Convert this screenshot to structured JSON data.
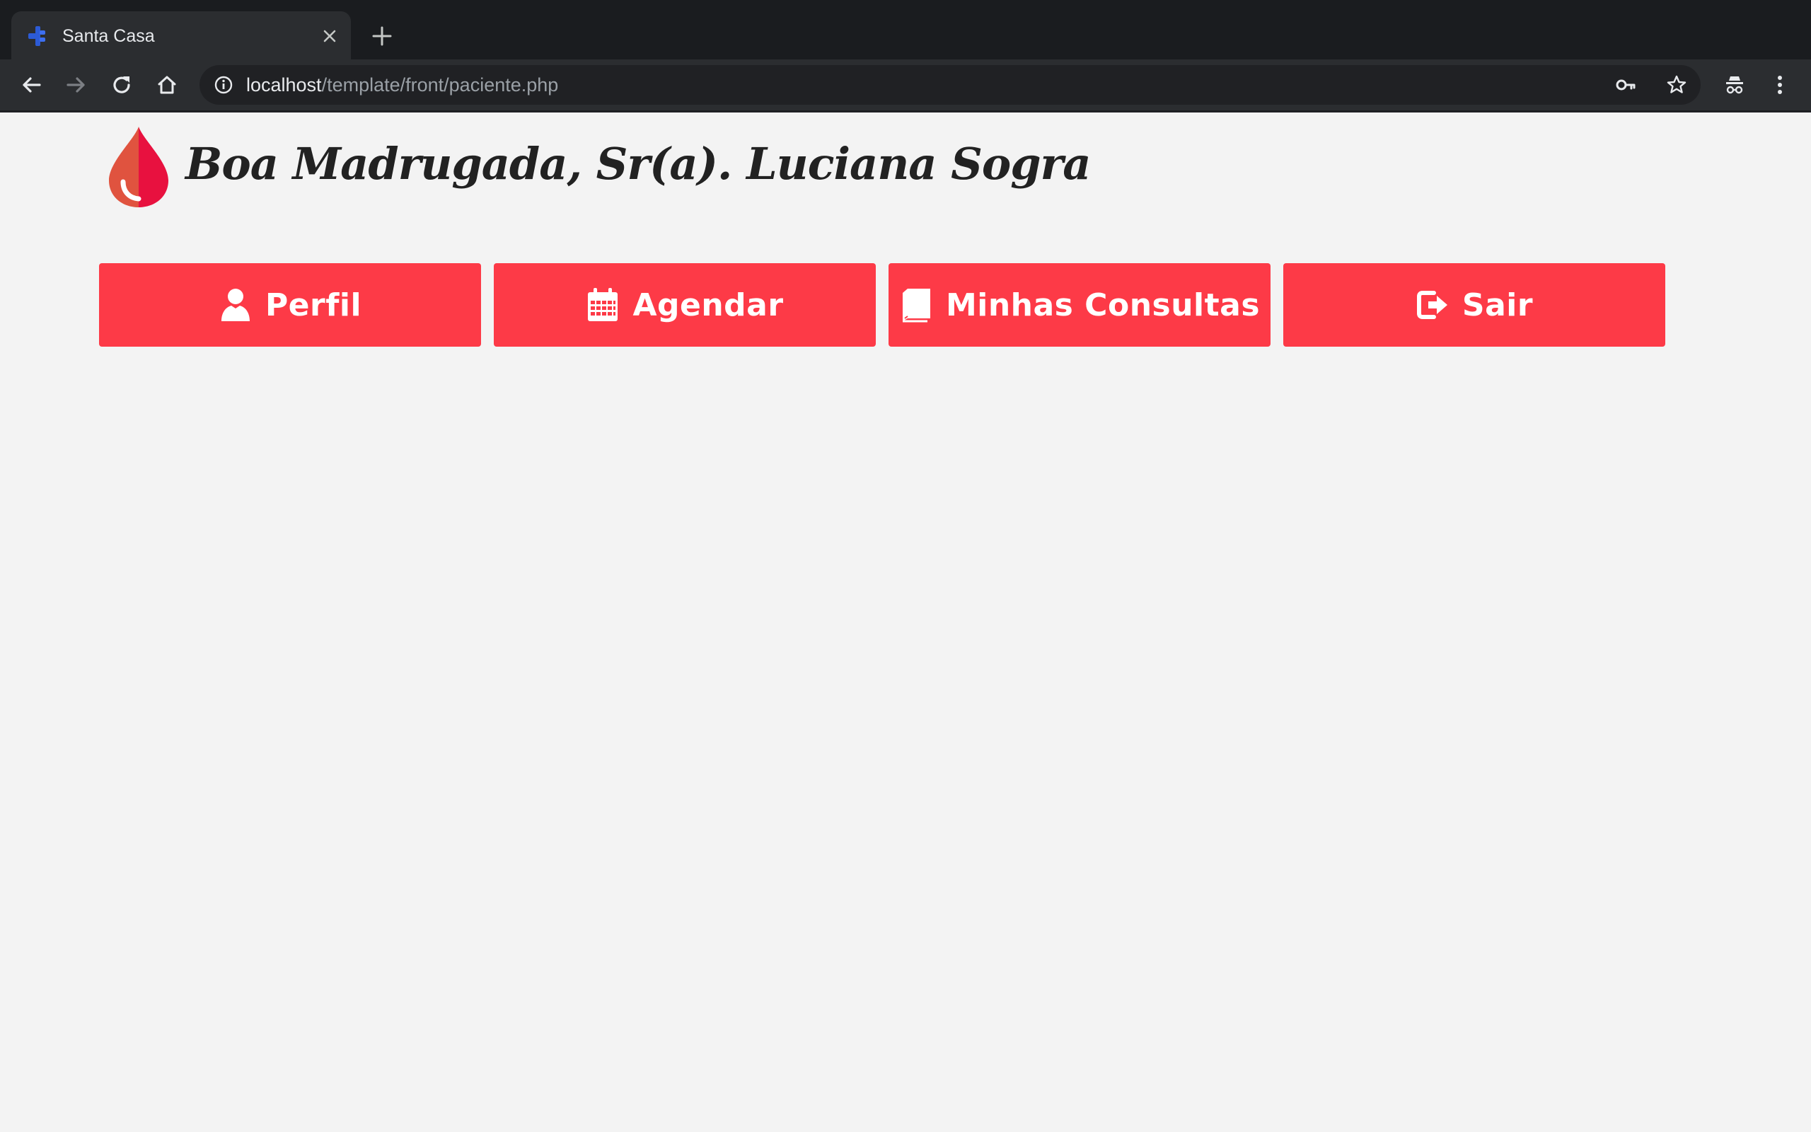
{
  "browser": {
    "tab": {
      "title": "Santa Casa"
    },
    "address_bar": {
      "host": "localhost",
      "path": "/template/front/paciente.php"
    },
    "icons": {
      "favicon": "medical-star-icon",
      "close": "close-icon",
      "new_tab": "plus-icon",
      "back": "back-arrow-icon",
      "forward": "forward-arrow-icon",
      "reload": "reload-icon",
      "home": "home-icon",
      "site_info": "info-icon",
      "passwords": "key-icon",
      "bookmark": "star-icon",
      "incognito": "incognito-icon",
      "menu": "kebab-menu-icon"
    }
  },
  "page": {
    "logo": "blood-drop-icon",
    "greeting": "Boa Madrugada, Sr(a). Luciana Sogra",
    "accent_color": "#fd3a47",
    "nav": [
      {
        "label": "Perfil",
        "icon": "user-icon"
      },
      {
        "label": "Agendar",
        "icon": "calendar-icon"
      },
      {
        "label": "Minhas Consultas",
        "icon": "book-icon"
      },
      {
        "label": "Sair",
        "icon": "sign-out-icon"
      }
    ]
  }
}
